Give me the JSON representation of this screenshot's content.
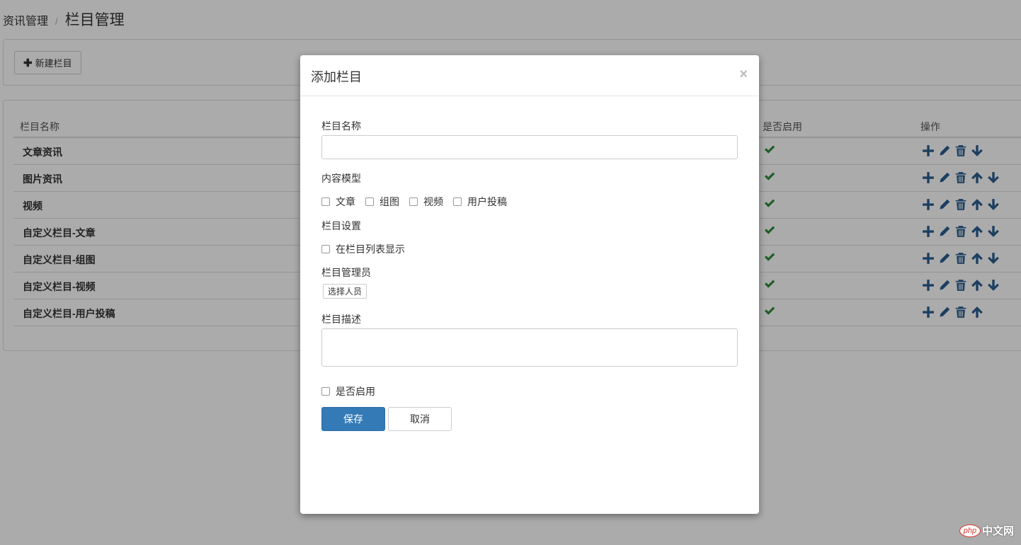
{
  "breadcrumb": {
    "parent": "资讯管理",
    "separator": "/",
    "current": "栏目管理"
  },
  "toolbar": {
    "new_label": "新建栏目"
  },
  "table": {
    "headers": {
      "name": "栏目名称",
      "enabled": "是否启用",
      "actions": "操作"
    },
    "rows": [
      {
        "name": "文章资讯",
        "enabled": true,
        "actions": [
          "add",
          "edit",
          "delete",
          "down"
        ]
      },
      {
        "name": "图片资讯",
        "enabled": true,
        "actions": [
          "add",
          "edit",
          "delete",
          "up",
          "down"
        ]
      },
      {
        "name": "视频",
        "enabled": true,
        "actions": [
          "add",
          "edit",
          "delete",
          "up",
          "down"
        ]
      },
      {
        "name": "自定义栏目-文章",
        "enabled": true,
        "actions": [
          "add",
          "edit",
          "delete",
          "up",
          "down"
        ]
      },
      {
        "name": "自定义栏目-组图",
        "enabled": true,
        "actions": [
          "add",
          "edit",
          "delete",
          "up",
          "down"
        ]
      },
      {
        "name": "自定义栏目-视频",
        "enabled": true,
        "actions": [
          "add",
          "edit",
          "delete",
          "up",
          "down"
        ]
      },
      {
        "name": "自定义栏目-用户投稿",
        "enabled": true,
        "actions": [
          "add",
          "edit",
          "delete",
          "up"
        ]
      }
    ]
  },
  "modal": {
    "title": "添加栏目",
    "close": "×",
    "name_label": "栏目名称",
    "name_value": "",
    "content_model_label": "内容模型",
    "content_models": [
      "文章",
      "组图",
      "视频",
      "用户投稿"
    ],
    "settings_label": "栏目设置",
    "show_in_list": "在栏目列表显示",
    "admin_label": "栏目管理员",
    "select_people": "选择人员",
    "desc_label": "栏目描述",
    "desc_value": "",
    "enabled_label": "是否启用",
    "save": "保存",
    "cancel": "取消"
  },
  "watermark": {
    "logo": "php",
    "text": "中文网"
  },
  "colors": {
    "primary": "#337ab7",
    "icon": "#2a5f8f",
    "check": "#2e8b3a"
  }
}
